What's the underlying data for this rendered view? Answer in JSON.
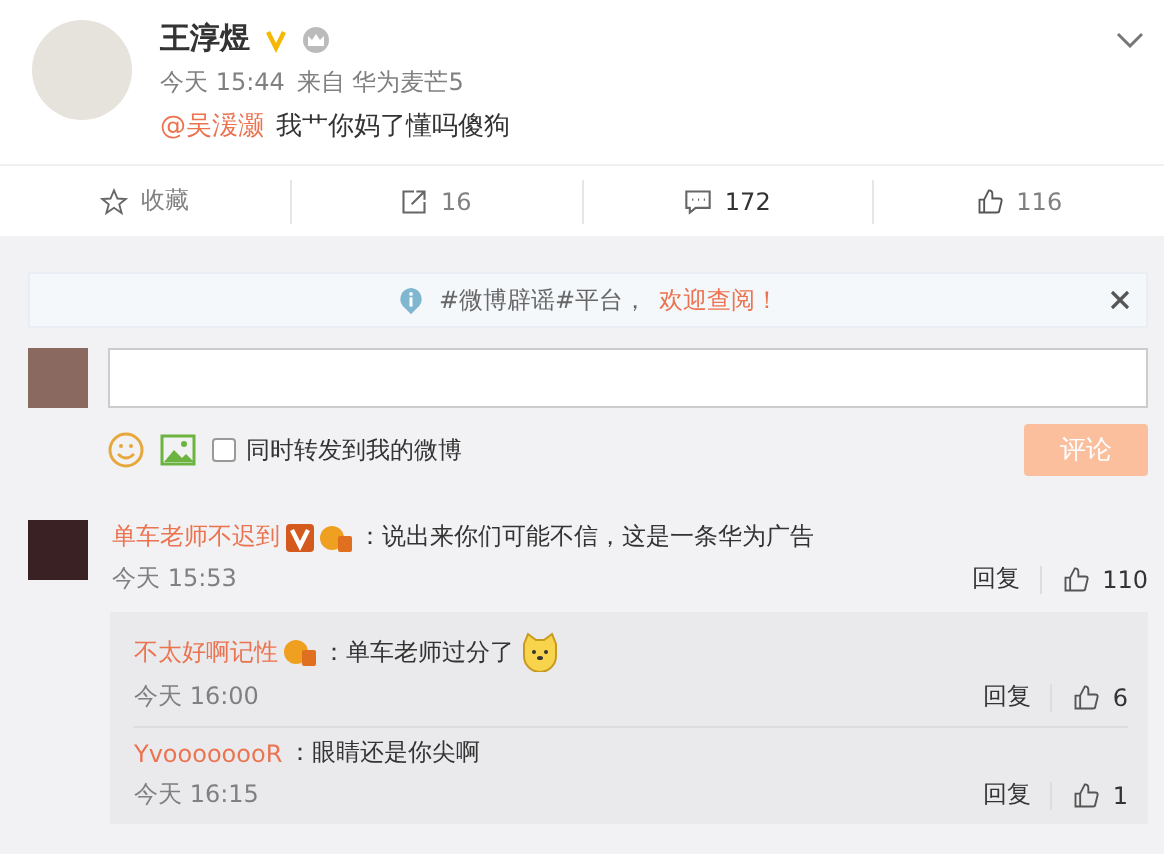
{
  "post": {
    "author": "王淳煜",
    "verified": true,
    "time": "今天 15:44",
    "source": "来自 华为麦芒5",
    "mention": "@吴湲灏",
    "text": "我艹你妈了懂吗傻狗"
  },
  "actions": [
    {
      "kind": "favorite",
      "label": "收藏",
      "selected": false
    },
    {
      "kind": "repost",
      "label": "16",
      "selected": false
    },
    {
      "kind": "comment",
      "label": "172",
      "selected": true
    },
    {
      "kind": "like",
      "label": "116",
      "selected": false
    }
  ],
  "notice": {
    "text": "#微博辟谣#平台，",
    "link": "欢迎查阅！"
  },
  "composer": {
    "repost_label": "同时转发到我的微博",
    "repost_checked": false,
    "submit": "评论",
    "submit_disabled": true
  },
  "comments": [
    {
      "author": "单车老师不迟到",
      "verified": true,
      "text": "：说出来你们可能不信，这是一条华为广告",
      "time": "今天 15:53",
      "reply": "回复",
      "likes": "110",
      "replies": [
        {
          "author": "不太好啊记性",
          "verified": false,
          "text": "：单车老师过分了",
          "emoji": true,
          "time": "今天 16:00",
          "reply": "回复",
          "likes": "6"
        },
        {
          "author": "YvoooooooR",
          "verified": false,
          "text": "：眼睛还是你尖啊",
          "emoji": false,
          "time": "今天 16:15",
          "reply": "回复",
          "likes": "1"
        }
      ]
    }
  ]
}
